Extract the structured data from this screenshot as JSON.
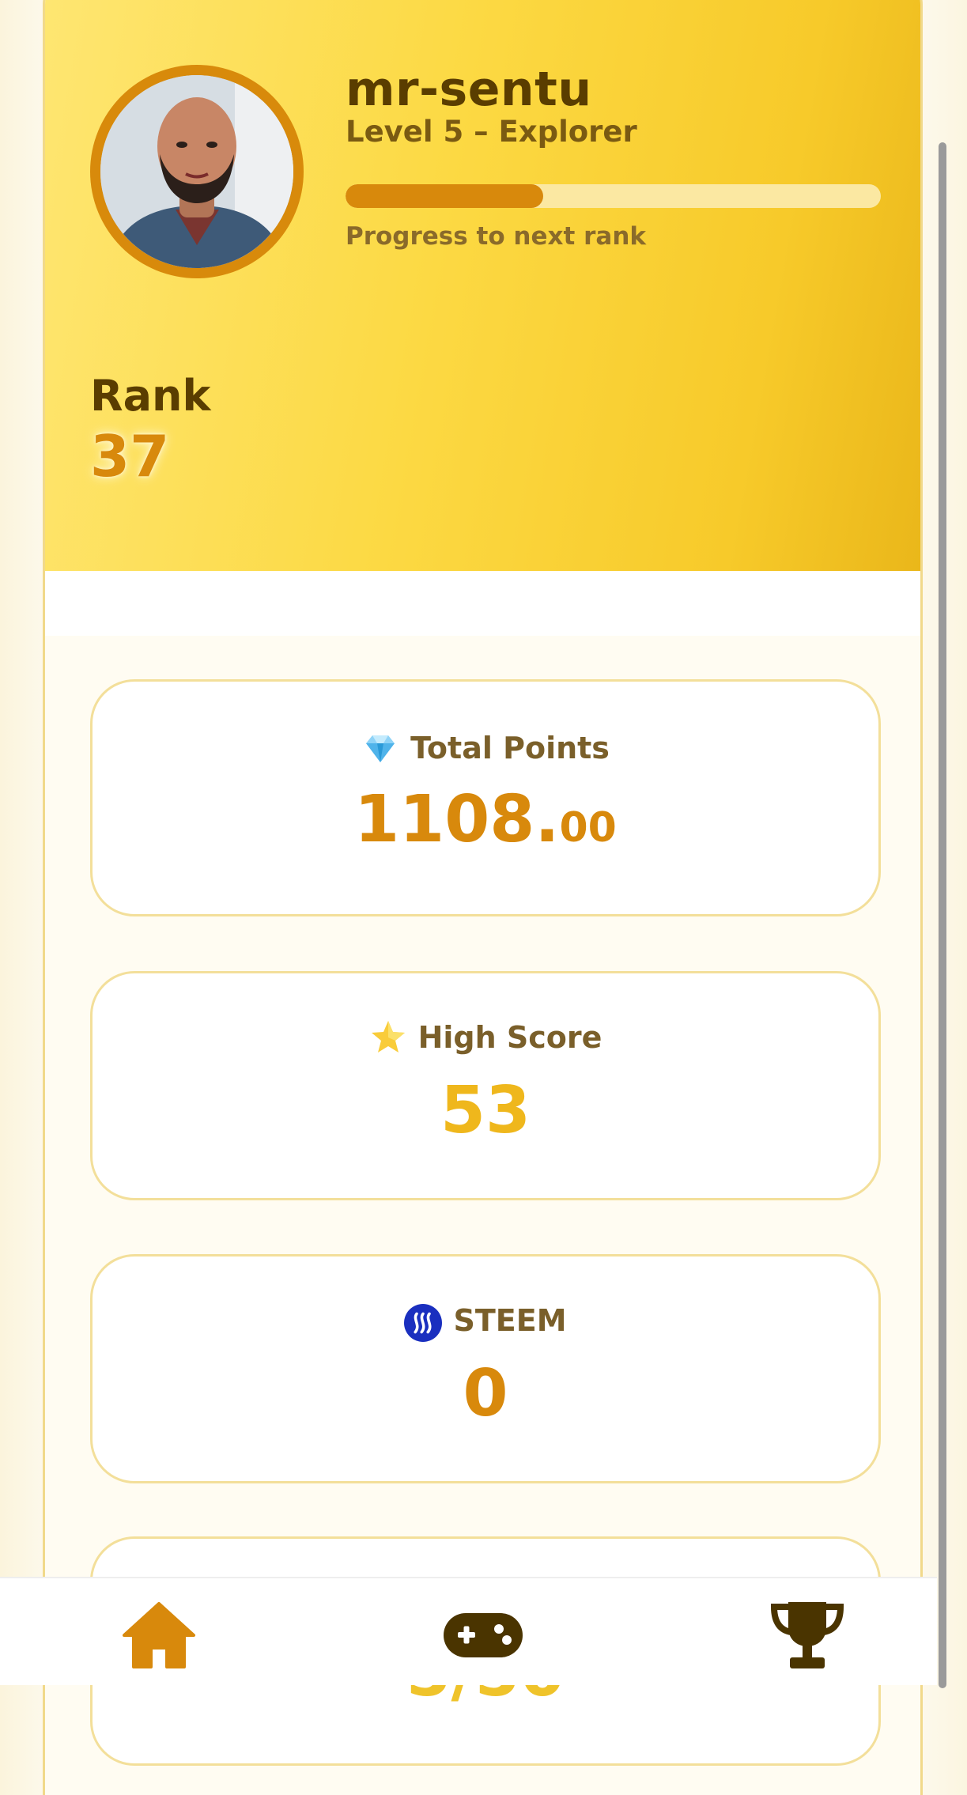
{
  "profile": {
    "username": "mr-sentu",
    "level": "Level 5 – Explorer",
    "progress": 0.37,
    "progress_label": "Progress to next rank",
    "rank_label": "Rank",
    "rank_value": "37"
  },
  "stats": [
    {
      "icon": "gem-icon",
      "title": "Total Points",
      "value_int": "1108.",
      "value_dec": "00",
      "color": "#d8890c"
    },
    {
      "icon": "star-icon",
      "title": "High Score",
      "value_int": "53",
      "value_dec": "",
      "color": "#efb71c"
    },
    {
      "icon": "steem-icon",
      "title": "STEEM",
      "value_int": "0",
      "value_dec": "",
      "color": "#d8890c"
    },
    {
      "icon": "",
      "title": "",
      "value_int": "5/50",
      "value_dec": "",
      "color": "#efc32a"
    }
  ],
  "nav": {
    "items": [
      {
        "icon": "home-icon",
        "active": true
      },
      {
        "icon": "gamepad-icon",
        "active": false
      },
      {
        "icon": "trophy-icon",
        "active": false
      }
    ]
  },
  "colors": {
    "accent": "#d8890c",
    "dark_text": "#5a3d00",
    "gold": "#efb71c"
  }
}
